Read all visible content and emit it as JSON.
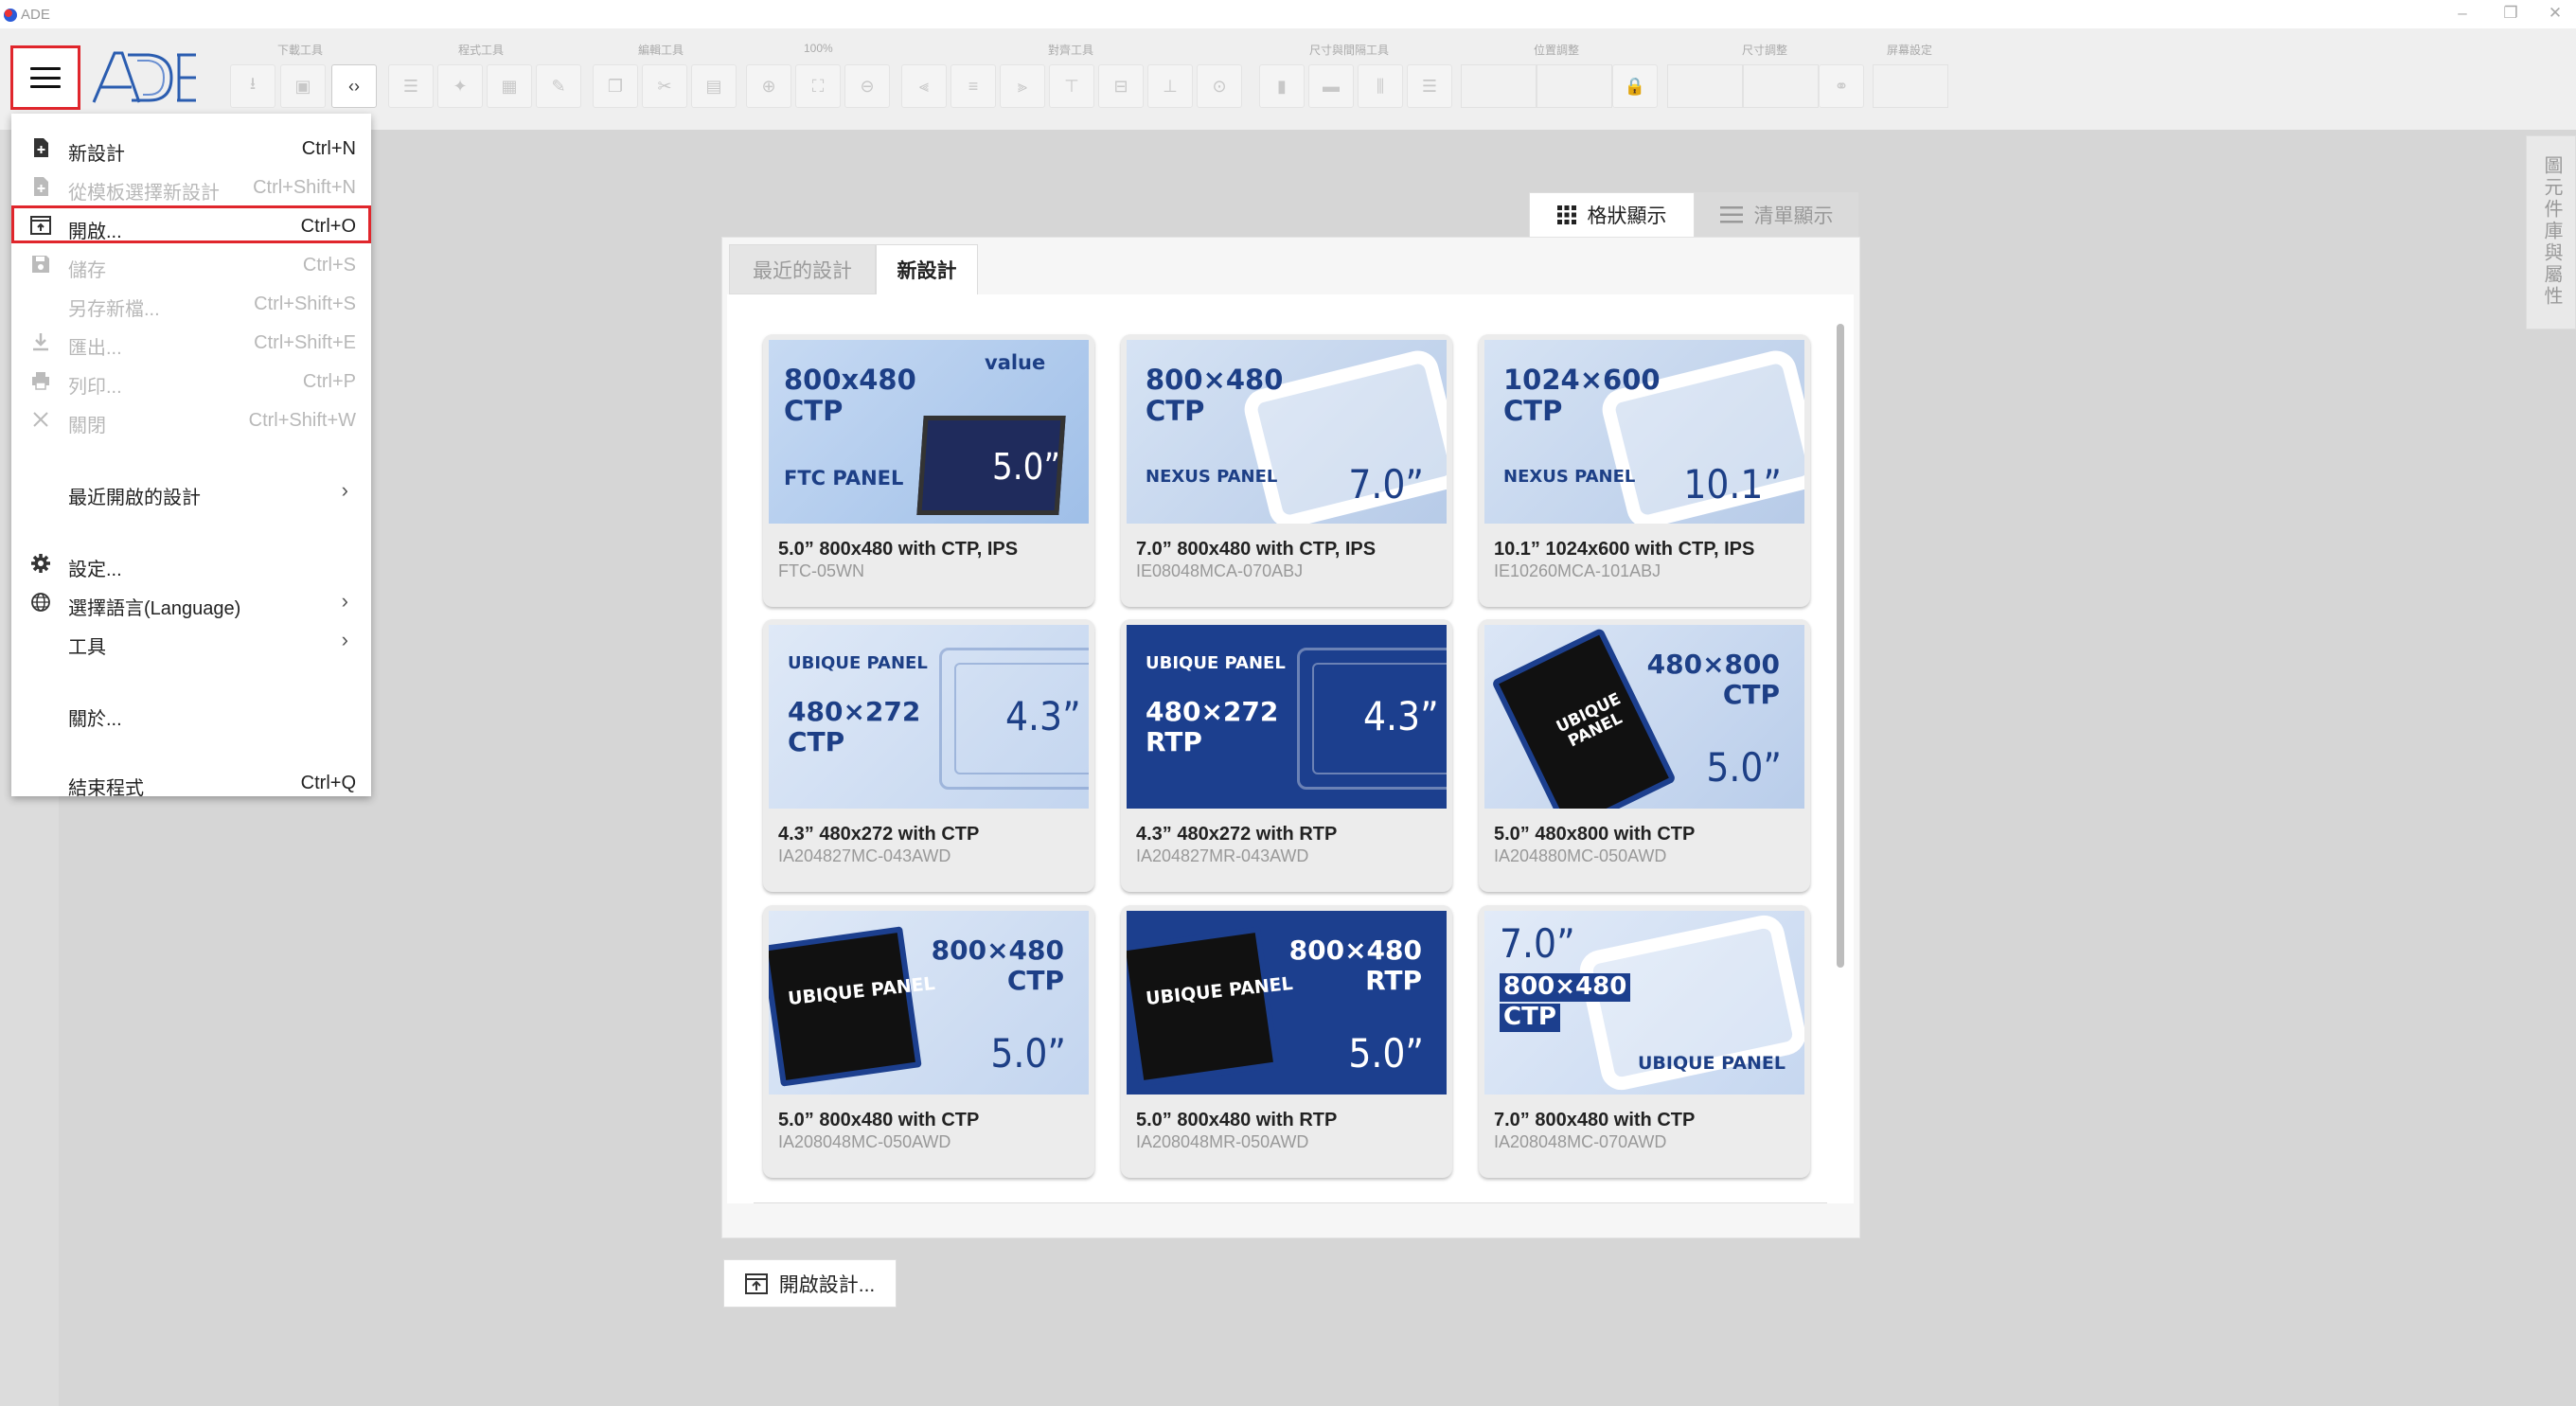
{
  "window": {
    "title": "ADE",
    "controls": {
      "minimize": "–",
      "restore": "❐",
      "close": "✕"
    }
  },
  "toolbar": {
    "groups": [
      "下載工具",
      "程式工具",
      "編輯工具",
      "100%",
      "對齊工具",
      "尺寸與間隔工具",
      "位置調整",
      "尺寸調整",
      "屏幕設定"
    ],
    "logo_text": "ADE"
  },
  "file_menu": {
    "items": [
      {
        "label": "新設計",
        "shortcut": "Ctrl+N",
        "icon": "new-file-icon",
        "enabled": true
      },
      {
        "label": "從模板選擇新設計",
        "shortcut": "Ctrl+Shift+N",
        "icon": "template-file-icon",
        "enabled": false
      },
      {
        "label": "開啟...",
        "shortcut": "Ctrl+O",
        "icon": "open-icon",
        "enabled": true
      },
      {
        "label": "儲存",
        "shortcut": "Ctrl+S",
        "icon": "save-icon",
        "enabled": false
      },
      {
        "label": "另存新檔...",
        "shortcut": "Ctrl+Shift+S",
        "icon": "",
        "enabled": false
      },
      {
        "label": "匯出...",
        "shortcut": "Ctrl+Shift+E",
        "icon": "download-icon",
        "enabled": false
      },
      {
        "label": "列印...",
        "shortcut": "Ctrl+P",
        "icon": "print-icon",
        "enabled": false
      },
      {
        "label": "關閉",
        "shortcut": "Ctrl+Shift+W",
        "icon": "close-icon",
        "enabled": false
      },
      {
        "label": "最近開啟的設計",
        "shortcut": "",
        "icon": "",
        "enabled": true,
        "submenu": true
      },
      {
        "label": "設定...",
        "shortcut": "",
        "icon": "gear-icon",
        "enabled": true
      },
      {
        "label": "選擇語言(Language)",
        "shortcut": "",
        "icon": "globe-icon",
        "enabled": true,
        "submenu": true
      },
      {
        "label": "工具",
        "shortcut": "",
        "icon": "",
        "enabled": true,
        "submenu": true
      },
      {
        "label": "關於...",
        "shortcut": "",
        "icon": "",
        "enabled": true
      },
      {
        "label": "結束程式",
        "shortcut": "Ctrl+Q",
        "icon": "",
        "enabled": true
      }
    ]
  },
  "view_toggle": {
    "grid_label": "格狀顯示",
    "list_label": "清單顯示"
  },
  "tabs": {
    "recent": "最近的設計",
    "new": "新設計"
  },
  "right_rail": {
    "label": "圖元件庫與屬性"
  },
  "cards": [
    {
      "title": "5.0” 800x480 with CTP, IPS",
      "model": "FTC-05WN",
      "thumb": {
        "res": "800x480",
        "touch": "CTP",
        "brand": "FTC PANEL",
        "size": "5.0”",
        "logo": "value",
        "style": "ftc"
      }
    },
    {
      "title": "7.0” 800x480 with CTP, IPS",
      "model": "IE08048MCA-070ABJ",
      "thumb": {
        "res": "800×480",
        "touch": "CTP",
        "brand": "NEXUS PANEL",
        "size": "7.0”",
        "style": "nexus"
      }
    },
    {
      "title": "10.1” 1024x600 with CTP, IPS",
      "model": "IE10260MCA-101ABJ",
      "thumb": {
        "res": "1024×600",
        "touch": "CTP",
        "brand": "NEXUS PANEL",
        "size": "10.1”",
        "style": "nexus"
      }
    },
    {
      "title": "4.3” 480x272 with CTP",
      "model": "IA204827MC-043AWD",
      "thumb": {
        "res": "480×272",
        "touch": "CTP",
        "brand": "UBIQUE PANEL",
        "size": "4.3”",
        "style": "ubique-light"
      }
    },
    {
      "title": "4.3” 480x272 with RTP",
      "model": "IA204827MR-043AWD",
      "thumb": {
        "res": "480×272",
        "touch": "RTP",
        "brand": "UBIQUE PANEL",
        "size": "4.3”",
        "style": "ubique-dark"
      }
    },
    {
      "title": "5.0” 480x800 with CTP",
      "model": "IA204880MC-050AWD",
      "thumb": {
        "res": "480×800",
        "touch": "CTP",
        "brand": "UBIQUE PANEL",
        "size": "5.0”",
        "style": "portrait"
      }
    },
    {
      "title": "5.0” 800x480 with CTP",
      "model": "IA208048MC-050AWD",
      "thumb": {
        "res": "800×480",
        "touch": "CTP",
        "brand": "UBIQUE PANEL",
        "size": "5.0”",
        "style": "black-light"
      }
    },
    {
      "title": "5.0” 800x480 with RTP",
      "model": "IA208048MR-050AWD",
      "thumb": {
        "res": "800×480",
        "touch": "RTP",
        "brand": "UBIQUE PANEL",
        "size": "5.0”",
        "style": "black-dark"
      }
    },
    {
      "title": "7.0” 800x480 with CTP",
      "model": "IA208048MC-070AWD",
      "thumb": {
        "res": "800×480",
        "touch": "CTP",
        "brand": "UBIQUE PANEL",
        "size": "7.0”",
        "style": "frame7"
      }
    }
  ],
  "open_design_button": {
    "label": "開啟設計..."
  }
}
